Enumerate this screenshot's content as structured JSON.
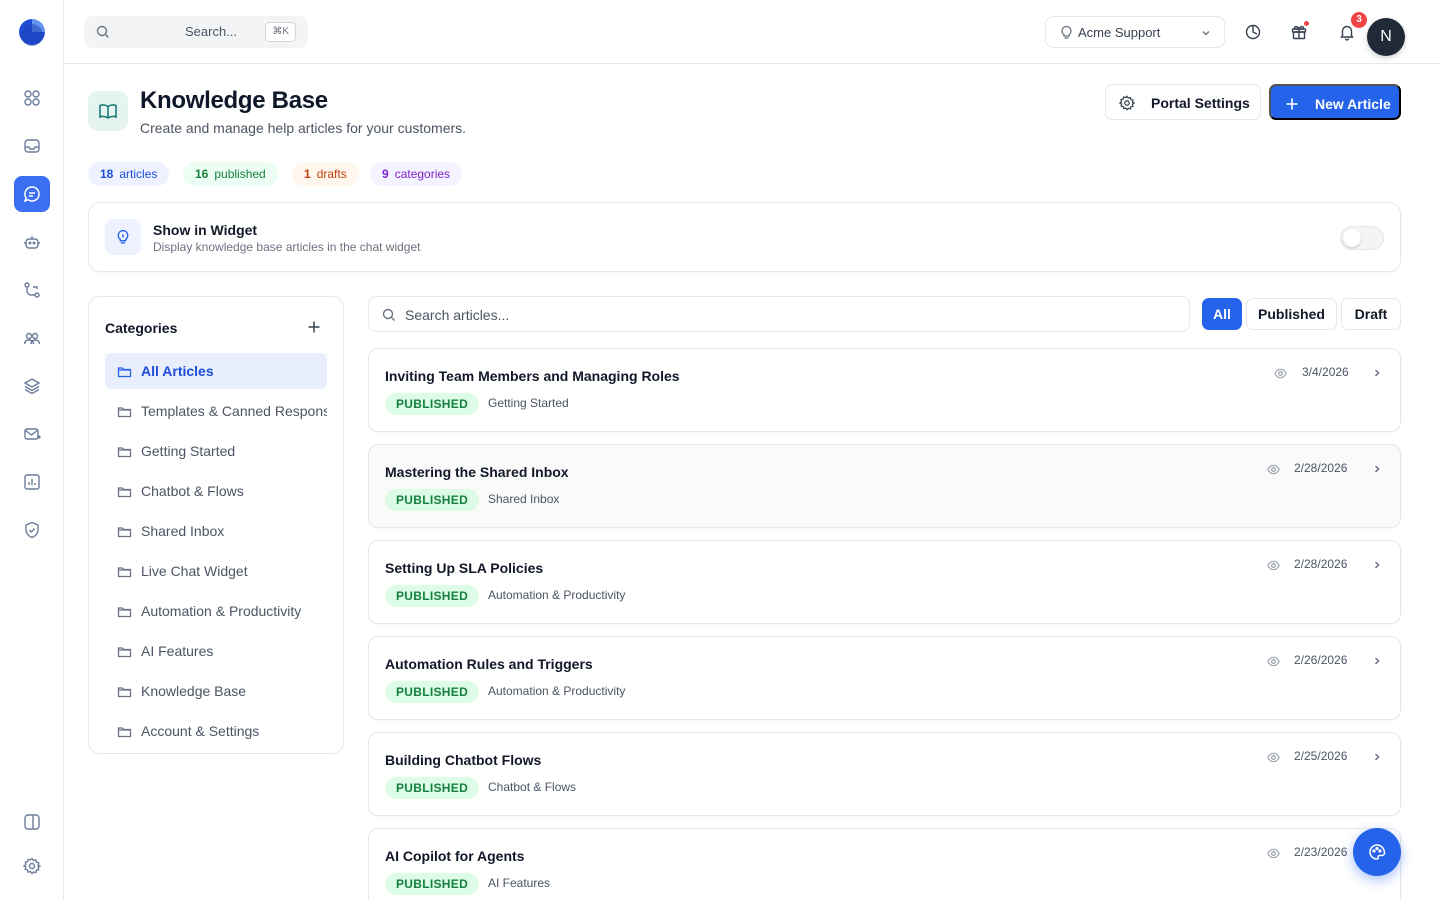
{
  "topbar": {
    "search_placeholder": "Search...",
    "search_shortcut": "⌘K",
    "workspace": "Acme Support",
    "notification_count": "3",
    "avatar_initial": "N"
  },
  "header": {
    "title": "Knowledge Base",
    "subtitle": "Create and manage help articles for your customers.",
    "portal_settings_label": "Portal Settings",
    "new_article_label": "New Article"
  },
  "stats": [
    {
      "count": "18",
      "label": "articles",
      "color": "#1d4ed8",
      "bg": "#eef2ff"
    },
    {
      "count": "16",
      "label": "published",
      "color": "#15803d",
      "bg": "#ecfdf3"
    },
    {
      "count": "1",
      "label": "drafts",
      "color": "#c2410c",
      "bg": "#fff7ed"
    },
    {
      "count": "9",
      "label": "categories",
      "color": "#7e22ce",
      "bg": "#f5f3ff"
    }
  ],
  "widget": {
    "title": "Show in Widget",
    "description": "Display knowledge base articles in the chat widget",
    "enabled": false
  },
  "categories": {
    "title": "Categories",
    "items": [
      {
        "label": "All Articles",
        "active": true
      },
      {
        "label": "Templates & Canned Responses",
        "active": false
      },
      {
        "label": "Getting Started",
        "active": false
      },
      {
        "label": "Chatbot & Flows",
        "active": false
      },
      {
        "label": "Shared Inbox",
        "active": false
      },
      {
        "label": "Live Chat Widget",
        "active": false
      },
      {
        "label": "Automation & Productivity",
        "active": false
      },
      {
        "label": "AI Features",
        "active": false
      },
      {
        "label": "Knowledge Base",
        "active": false
      },
      {
        "label": "Account & Settings",
        "active": false
      }
    ]
  },
  "articles_toolbar": {
    "search_placeholder": "Search articles...",
    "filters": [
      {
        "label": "All",
        "active": true
      },
      {
        "label": "Published",
        "active": false
      },
      {
        "label": "Draft",
        "active": false
      }
    ]
  },
  "articles": [
    {
      "title": "Inviting Team Members and Managing Roles",
      "status": "PUBLISHED",
      "category": "Getting Started",
      "date": "3/4/2026"
    },
    {
      "title": "Mastering the Shared Inbox",
      "status": "PUBLISHED",
      "category": "Shared Inbox",
      "date": "2/28/2026"
    },
    {
      "title": "Setting Up SLA Policies",
      "status": "PUBLISHED",
      "category": "Automation & Productivity",
      "date": "2/28/2026"
    },
    {
      "title": "Automation Rules and Triggers",
      "status": "PUBLISHED",
      "category": "Automation & Productivity",
      "date": "2/26/2026"
    },
    {
      "title": "Building Chatbot Flows",
      "status": "PUBLISHED",
      "category": "Chatbot & Flows",
      "date": "2/25/2026"
    },
    {
      "title": "AI Copilot for Agents",
      "status": "PUBLISHED",
      "category": "AI Features",
      "date": "2/23/2026"
    }
  ],
  "icons": {
    "rail": [
      "grid-icon",
      "inbox-icon",
      "chat-icon",
      "bot-icon",
      "flow-icon",
      "team-icon",
      "layers-icon",
      "mail-icon",
      "chart-icon",
      "shield-icon",
      "panel-icon",
      "gear-icon"
    ],
    "accent": "#2563eb"
  }
}
